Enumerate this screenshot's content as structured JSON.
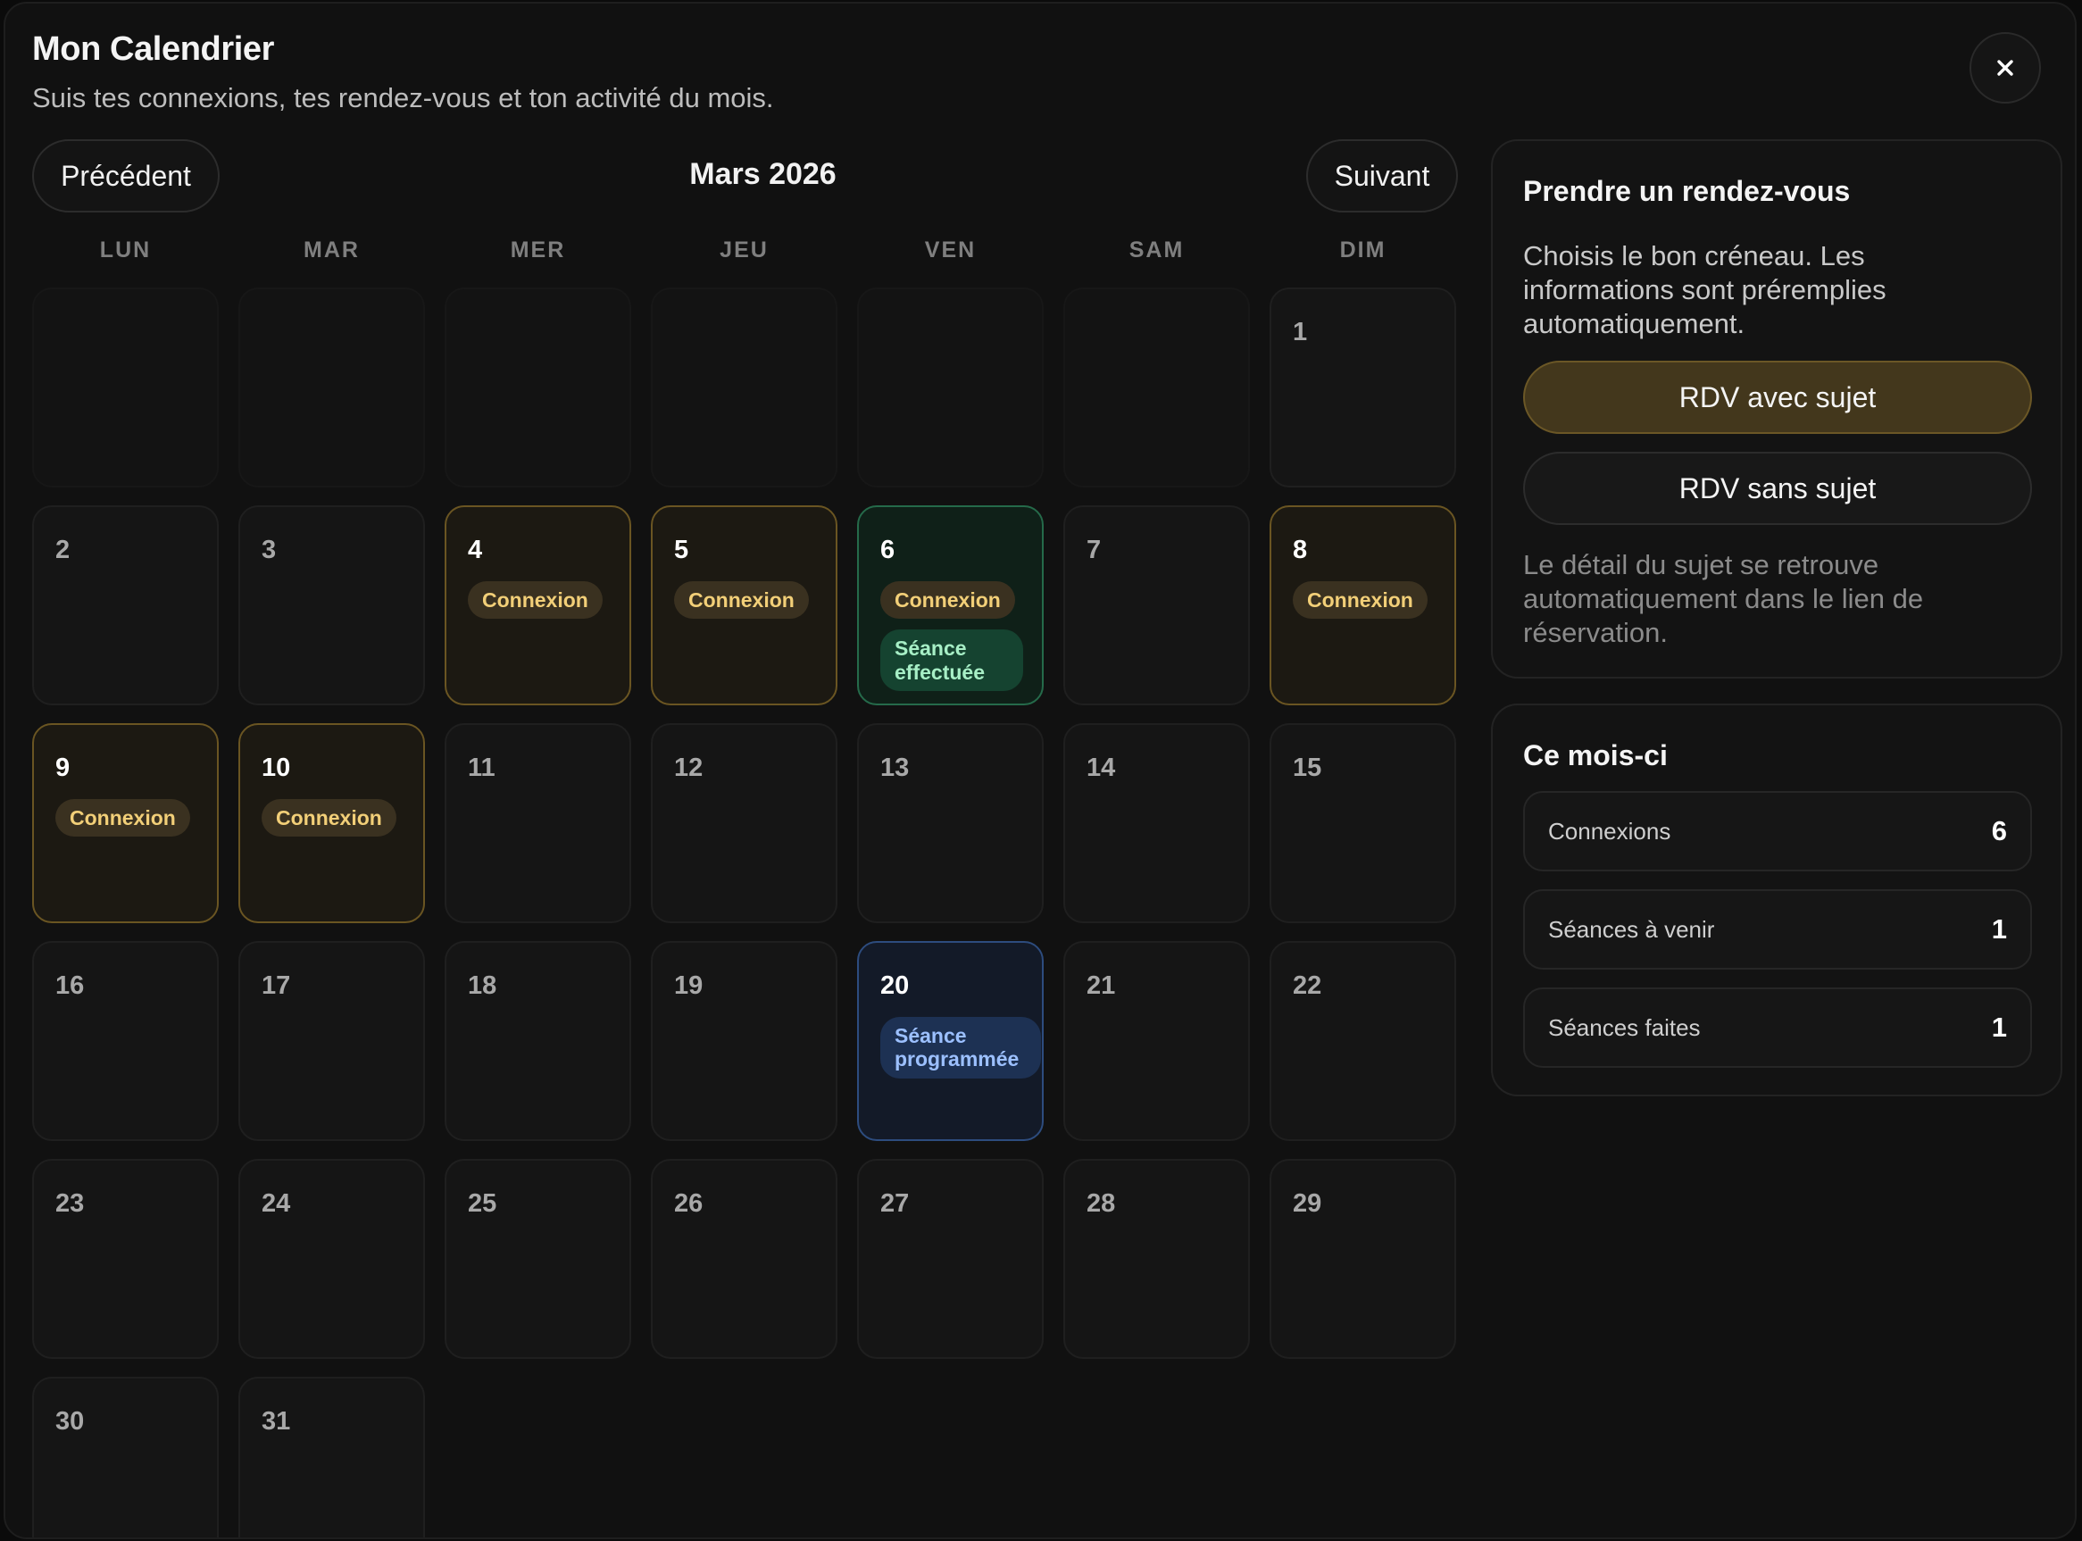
{
  "header": {
    "title": "Mon Calendrier",
    "subtitle": "Suis tes connexions, tes rendez-vous et ton activité du mois.",
    "close_label": "×"
  },
  "calendar": {
    "prev_label": "Précédent",
    "next_label": "Suivant",
    "month_label": "Mars 2026",
    "weekdays": [
      "LUN",
      "MAR",
      "MER",
      "JEU",
      "VEN",
      "SAM",
      "DIM"
    ],
    "badges": {
      "connexion": "Connexion",
      "seance_effectuee": "Séance effectuée",
      "seance_programmee": "Séance programmée"
    },
    "days": [
      {
        "num": "1"
      },
      {
        "num": "2"
      },
      {
        "num": "3"
      },
      {
        "num": "4",
        "status": "connexion"
      },
      {
        "num": "5",
        "status": "connexion"
      },
      {
        "num": "6",
        "status": "connexion+seance_effectuee"
      },
      {
        "num": "7"
      },
      {
        "num": "8",
        "status": "connexion"
      },
      {
        "num": "9",
        "status": "connexion"
      },
      {
        "num": "10",
        "status": "connexion"
      },
      {
        "num": "11"
      },
      {
        "num": "12"
      },
      {
        "num": "13"
      },
      {
        "num": "14"
      },
      {
        "num": "15"
      },
      {
        "num": "16"
      },
      {
        "num": "17"
      },
      {
        "num": "18"
      },
      {
        "num": "19"
      },
      {
        "num": "20",
        "status": "seance_programmee"
      },
      {
        "num": "21"
      },
      {
        "num": "22"
      },
      {
        "num": "23"
      },
      {
        "num": "24"
      },
      {
        "num": "25"
      },
      {
        "num": "26"
      },
      {
        "num": "27"
      },
      {
        "num": "28"
      },
      {
        "num": "29"
      },
      {
        "num": "30"
      },
      {
        "num": "31"
      }
    ]
  },
  "rdv_panel": {
    "title": "Prendre un rendez-vous",
    "description": "Choisis le bon créneau. Les informations sont préremplies automatiquement.",
    "with_subject_label": "RDV avec sujet",
    "without_subject_label": "RDV sans sujet",
    "note": "Le détail du sujet se retrouve automatiquement dans le lien de réservation."
  },
  "stats_panel": {
    "title": "Ce mois-ci",
    "rows": [
      {
        "label": "Connexions",
        "value": "6"
      },
      {
        "label": "Séances à venir",
        "value": "1"
      },
      {
        "label": "Séances faites",
        "value": "1"
      }
    ]
  },
  "colors": {
    "background": "#111111",
    "connexion_accent": "#f2cf78",
    "done_accent": "#a7efc6",
    "scheduled_accent": "#9cc0ff",
    "primary_button": "#43371c"
  }
}
